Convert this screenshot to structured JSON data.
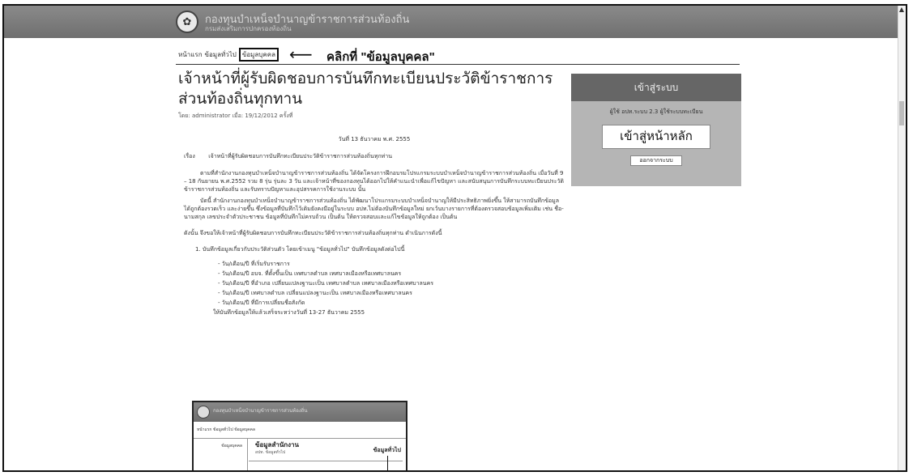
{
  "header": {
    "logo_glyph": "✿",
    "site_title": "กองทุนบำเหน็จบำนาญข้าราชการส่วนท้องถิ่น",
    "site_subtitle": "กรมส่งเสริมการปกครองท้องถิ่น"
  },
  "breadcrumb": {
    "items": [
      "หน้าแรก",
      "ข้อมูลทั่วไป",
      "ข้อมูลบุคคล"
    ]
  },
  "annotation": {
    "arrow": "⟵",
    "text": "คลิกที่ \"ข้อมูลบุคคล\""
  },
  "page": {
    "title": "เจ้าหน้าที่ผู้รับผิดชอบการบันทึกทะเบียนประวัติข้าราชการส่วนท้องถิ่นทุกทาน",
    "meta": "โดย: administrator เมื่อ: 19/12/2012 ครั้งที่"
  },
  "login": {
    "heading": "เข้าสู่ระบบ",
    "info": "ผู้ใช้ อปท.ระบบ 2.3 ผู้ใช้ระบบทะเบียน",
    "main_button": "เข้าสู่หน้าหลัก",
    "logout_button": "ออกจากระบบ"
  },
  "content": {
    "date_line": "วันที่ 13 ธันวาคม พ.ศ. 2555",
    "subject_label": "เรื่อง",
    "subject": "เจ้าหน้าที่ผู้รับผิดชอบการบันทึกทะเบียนประวัติข้าราชการส่วนท้องถิ่นทุกท่าน",
    "para1": "ตามที่สำนักงานกองทุนบำเหน็จบำนาญข้าราชการส่วนท้องถิ่น ได้จัดโครงการฝึกอบรมโปรแกรมระบบบำเหน็จบำนาญข้าราชการส่วนท้องถิ่น เมื่อวันที่ 9 – 18 กันยายน พ.ศ.2552 รวม 8 รุ่น รุ่นละ 3 วัน และเจ้าหน้าที่ของกองทุนได้ออกไปให้คำแนะนำเพื่อแก้ไขปัญหา และสนับสนุนการบันทึกระบบทะเบียนประวัติข้าราชการส่วนท้องถิ่น และรับทราบปัญหาและอุปสรรคการใช้งานระบบ นั้น",
    "para2": "บัดนี้ สำนักงานกองทุนบำเหน็จบำนาญข้าราชการส่วนท้องถิ่น ได้พัฒนาโปรแกรมระบบบำเหน็จบำนาญให้มีประสิทธิภาพยิ่งขึ้น ให้สามารถบันทึกข้อมูลได้ถูกต้องรวดเร็ว และง่ายขึ้น ซึ่งข้อมูลที่บันทึกไว้เดิมยังคงมีอยู่ในระบบ อปท.ไม่ต้องบันทึกข้อมูลใหม่ ยกเว้นบางรายการที่ต้องตรวจสอบข้อมูลเพิ่มเติม เช่น ชื่อ-นามสกุล เลขประจำตัวประชาชน ข้อมูลที่บันทึกไม่ครบถ้วน เป็นต้น ให้ตรวจสอบและแก้ไขข้อมูลให้ถูกต้อง เป็นต้น",
    "notice": "ดังนั้น จึงขอให้เจ้าหน้าที่ผู้รับผิดชอบการบันทึกทะเบียนประวัติข้าราชการส่วนท้องถิ่นทุกท่าน ดำเนินการดังนี้",
    "step1": "1. บันทึกข้อมูลเกี่ยวกับประวัติส่วนตัว โดยเข้าเมนู \"ข้อมูลทั่วไป\" บันทึกข้อมูลดังต่อไปนี้",
    "bullets": [
      "- วัน/เดือน/ปี ที่เริ่มรับราชการ",
      "- วัน/เดือน/ปี อบจ. ที่ตั้งขึ้นเป็น เทศบาลตำบล เทศบาลเมืองหรือเทศบาลนคร",
      "- วัน/เดือน/ปี ที่อำเภอ เปลี่ยนแปลงฐานะเป็น เทศบาลตำบล เทศบาลเมืองหรือเทศบาลนคร",
      "- วัน/เดือน/ปี เทศบาลตำบล เปลี่ยนแปลงฐานะเป็น เทศบาลเมืองหรือเทศบาลนคร",
      "- วัน/เดือน/ปี ที่มีการเปลี่ยนชื่อสังกัด"
    ],
    "deadline": "ให้บันทึกข้อมูลให้แล้วเสร็จระหว่างวันที่ 13-27 ธันวาคม 2555"
  },
  "mini_screenshot": {
    "title": "กองทุนบำเหน็จบำนาญข้าราชการส่วนท้องถิ่น",
    "crumb": "หน้าแรก ข้อมูลทั่วไป ข้อมูลบุคคล",
    "side": "ข้อมูลบุคคล",
    "heading": "ข้อมูลสำนักงาน",
    "sub": "อปท. ข้อมูลทั่วไป",
    "action": "ข้อมูลทั่วไป"
  },
  "icons": {
    "scroll_up": "▲"
  }
}
